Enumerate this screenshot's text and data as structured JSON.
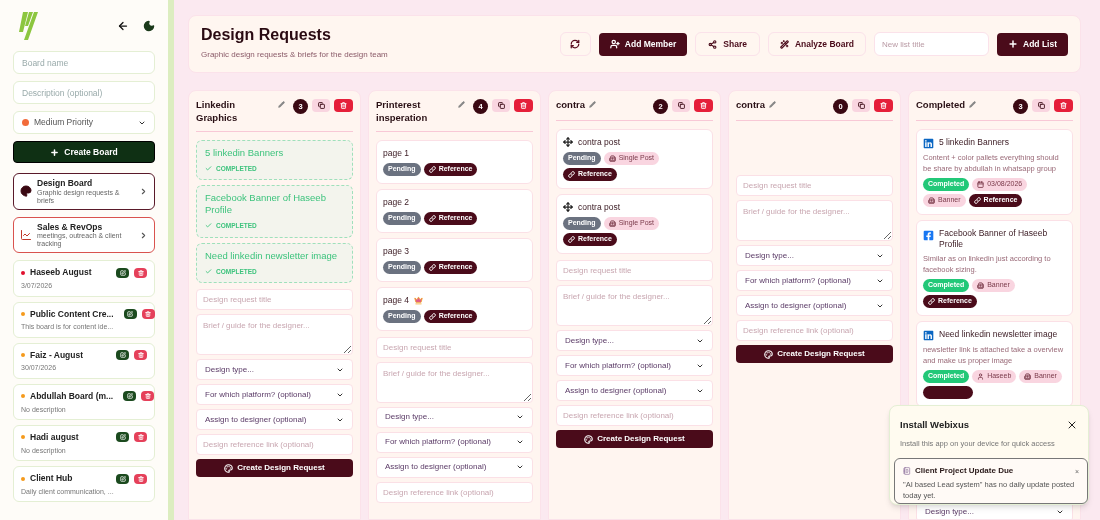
{
  "sidebar": {
    "board_name_placeholder": "Board name",
    "description_placeholder": "Description (optional)",
    "priority": {
      "label": "Medium Priority",
      "color": "#f26b3a"
    },
    "create_button": "Create Board",
    "nav_boards": [
      {
        "kind": "design",
        "title": "Design Board",
        "subtitle": "Graphic design requests & briefs",
        "color": "#5a1a2a"
      },
      {
        "kind": "sales",
        "title": "Sales & RevOps",
        "subtitle": "meetings, outreach & client tracking",
        "color": "#d9534f"
      }
    ],
    "boards": [
      {
        "name": "Haseeb August",
        "subtitle": "3/07/2026",
        "color": "#e0102e"
      },
      {
        "name": "Public Content Cre...",
        "subtitle": "This board is for content ide...",
        "color": "#f59a1c"
      },
      {
        "name": "Faiz - August",
        "subtitle": "30/07/2026",
        "color": "#f59a1c"
      },
      {
        "name": "Abdullah Board (m...",
        "subtitle": "No description",
        "color": "#f59a1c"
      },
      {
        "name": "Hadi august",
        "subtitle": "No description",
        "color": "#f59a1c"
      },
      {
        "name": "Client Hub",
        "subtitle": "Daily client communication, ...",
        "color": "#f59a1c"
      }
    ]
  },
  "header": {
    "title": "Design Requests",
    "subtitle": "Graphic design requests & briefs for the design team",
    "add_member": "Add Member",
    "share": "Share",
    "analyze": "Analyze Board",
    "new_list_placeholder": "New list title",
    "add_list": "Add List"
  },
  "columns": [
    {
      "title": "Linkedin Graphics",
      "count": "3",
      "cards": [
        {
          "kind": "done",
          "title": "5 linkedin Banners",
          "status": "COMPLETED"
        },
        {
          "kind": "done",
          "title": "Facebook Banner of Haseeb Profile",
          "status": "COMPLETED"
        },
        {
          "kind": "done",
          "title": "Need linkedin newsletter image",
          "status": "COMPLETED"
        }
      ],
      "form": [
        {
          "kind": "input",
          "placeholder": "Design request title"
        },
        {
          "kind": "textarea",
          "placeholder": "Brief / guide for the designer..."
        },
        {
          "kind": "select",
          "text": "Design type..."
        },
        {
          "kind": "select",
          "text": "For which platform? (optional)"
        },
        {
          "kind": "select",
          "text": "Assign to designer (optional)"
        },
        {
          "kind": "input",
          "placeholder": "Design reference link (optional)"
        },
        {
          "kind": "button",
          "text": "Create Design Request"
        }
      ]
    },
    {
      "title": "Printerest insperation",
      "count": "4",
      "cards": [
        {
          "kind": "plain",
          "title": "page 1",
          "badges": [
            {
              "kind": "pending",
              "text": "Pending"
            },
            {
              "kind": "reference",
              "text": "Reference"
            }
          ]
        },
        {
          "kind": "plain",
          "title": "page 2",
          "badges": [
            {
              "kind": "pending",
              "text": "Pending"
            },
            {
              "kind": "reference",
              "text": "Reference"
            }
          ]
        },
        {
          "kind": "plain",
          "title": "page 3",
          "badges": [
            {
              "kind": "pending",
              "text": "Pending"
            },
            {
              "kind": "reference",
              "text": "Reference"
            }
          ]
        },
        {
          "kind": "crown",
          "title": "page 4",
          "badges": [
            {
              "kind": "pending",
              "text": "Pending"
            },
            {
              "kind": "reference",
              "text": "Reference"
            }
          ]
        }
      ],
      "form": [
        {
          "kind": "input",
          "placeholder": "Design request title"
        },
        {
          "kind": "textarea",
          "placeholder": "Brief / guide for the designer..."
        },
        {
          "kind": "select",
          "text": "Design type..."
        },
        {
          "kind": "select",
          "text": "For which platform? (optional)"
        },
        {
          "kind": "select",
          "text": "Assign to designer (optional)"
        },
        {
          "kind": "input",
          "placeholder": "Design reference link (optional)"
        }
      ]
    },
    {
      "title": "contra",
      "count": "2",
      "cards": [
        {
          "kind": "move",
          "title": "contra post",
          "badges": [
            {
              "kind": "pending",
              "text": "Pending"
            },
            {
              "kind": "type",
              "text": "Single Post"
            },
            {
              "kind": "reference",
              "text": "Reference"
            }
          ]
        },
        {
          "kind": "move",
          "title": "contra post",
          "badges": [
            {
              "kind": "pending",
              "text": "Pending"
            },
            {
              "kind": "type",
              "text": "Single Post"
            },
            {
              "kind": "reference",
              "text": "Reference"
            }
          ]
        }
      ],
      "form": [
        {
          "kind": "input",
          "placeholder": "Design request title"
        },
        {
          "kind": "textarea",
          "placeholder": "Brief / guide for the designer..."
        },
        {
          "kind": "select",
          "text": "Design type..."
        },
        {
          "kind": "select",
          "text": "For which platform? (optional)"
        },
        {
          "kind": "select",
          "text": "Assign to designer (optional)"
        },
        {
          "kind": "input",
          "placeholder": "Design reference link (optional)"
        },
        {
          "kind": "button",
          "text": "Create Design Request"
        }
      ]
    },
    {
      "title": "contra",
      "count": "0",
      "form": [
        {
          "kind": "input",
          "placeholder": "Design request title"
        },
        {
          "kind": "textarea",
          "placeholder": "Brief / guide for the designer..."
        },
        {
          "kind": "select",
          "text": "Design type..."
        },
        {
          "kind": "select",
          "text": "For which platform? (optional)"
        },
        {
          "kind": "select",
          "text": "Assign to designer (optional)"
        },
        {
          "kind": "input",
          "placeholder": "Design reference link (optional)"
        },
        {
          "kind": "button",
          "text": "Create Design Request"
        }
      ]
    },
    {
      "title": "Completed",
      "count": "3",
      "cards": [
        {
          "kind": "linkedin",
          "title": "5 linkedin Banners",
          "description": "Content + color pallets everything should be share by abdullah in whatsapp group",
          "badges": [
            {
              "kind": "completed",
              "text": "Completed"
            },
            {
              "kind": "date",
              "text": "03/08/2026"
            },
            {
              "kind": "type",
              "text": "Banner"
            },
            {
              "kind": "reference",
              "text": "Reference"
            }
          ]
        },
        {
          "kind": "facebook",
          "title": "Facebook Banner of Haseeb Profile",
          "description": "Similar as on linkedin just according to facebook sizing.",
          "badges": [
            {
              "kind": "completed",
              "text": "Completed"
            },
            {
              "kind": "type",
              "text": "Banner"
            },
            {
              "kind": "reference",
              "text": "Reference"
            }
          ]
        },
        {
          "kind": "linkedin",
          "title": "Need linkedin newsletter image",
          "description": "newsletter link is attached take a overview and make us proper image",
          "badges": [
            {
              "kind": "completed",
              "text": "Completed"
            },
            {
              "kind": "assignee",
              "text": "Haseeb"
            },
            {
              "kind": "type",
              "text": "Banner"
            },
            {
              "kind": "reference_hidden"
            }
          ]
        }
      ],
      "form": [
        {
          "kind": "select",
          "text": "Design type..."
        }
      ]
    }
  ],
  "install_popup": {
    "title": "Install Webixus",
    "text": "Install this app on your device for quick access"
  },
  "toast": {
    "title": "Client Project Update Due",
    "text": "\"AI based Lead system\" has no daily update posted today yet.",
    "close": "×"
  }
}
